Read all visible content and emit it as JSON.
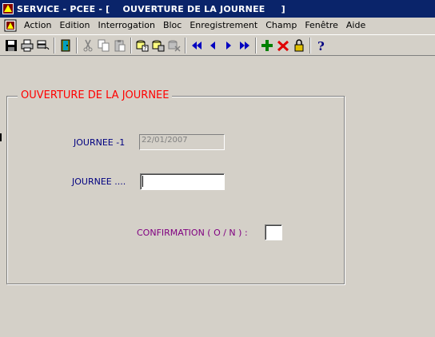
{
  "window": {
    "title": "SERVICE - PCEE - [    OUVERTURE DE LA JOURNEE     ]"
  },
  "menu": {
    "items": [
      "Action",
      "Edition",
      "Interrogation",
      "Bloc",
      "Enregistrement",
      "Champ",
      "Fenêtre",
      "Aide"
    ]
  },
  "toolbar": {
    "icons": [
      "save-icon",
      "print-icon",
      "print-setup-icon",
      "exit-door-icon",
      "cut-icon",
      "copy-icon",
      "paste-icon",
      "query-icon",
      "execute-query-icon",
      "cancel-query-icon",
      "first-record-icon",
      "previous-record-icon",
      "next-record-icon",
      "last-record-icon",
      "insert-record-icon",
      "delete-record-icon",
      "lock-record-icon",
      "help-icon"
    ]
  },
  "form": {
    "title": "OUVERTURE DE LA JOURNEE",
    "previous_day_label": "JOURNEE -1",
    "previous_day_value": "22/01/2007",
    "day_label": "JOURNEE ....",
    "day_value": "",
    "confirmation_label": "CONFIRMATION ( O / N ) :",
    "confirmation_value": ""
  }
}
